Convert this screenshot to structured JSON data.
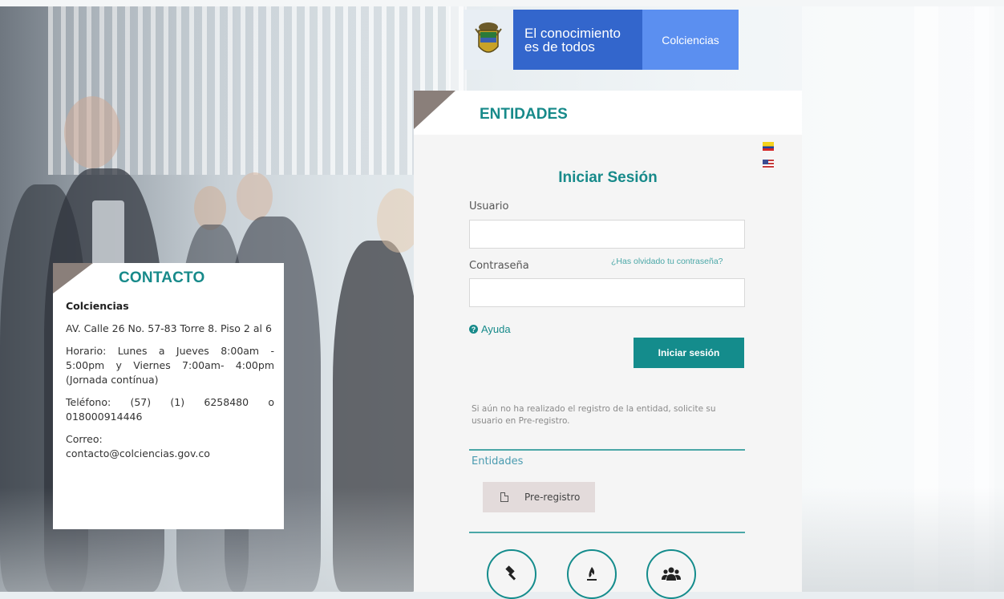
{
  "banner": {
    "slogan_line1": "El conocimiento",
    "slogan_line2": "es de todos",
    "brand": "Colciencias"
  },
  "contact": {
    "title": "CONTACTO",
    "org": "Colciencias",
    "address": "AV. Calle 26 No. 57-83 Torre 8. Piso 2 al 6",
    "hours": "Horario: Lunes a Jueves 8:00am - 5:00pm y Viernes 7:00am- 4:00pm (Jornada contínua)",
    "phone": "Teléfono: (57) (1) 6258480 o 018000914446",
    "email_label": "Correo:",
    "email": "contacto@colciencias.gov.co"
  },
  "panel": {
    "tab_title": "ENTIDADES",
    "login_title": "Iniciar Sesión",
    "user_label": "Usuario",
    "user_value": "",
    "password_label": "Contraseña",
    "password_value": "",
    "forgot_link": "¿Has olvidado tu contraseña?",
    "help_link": "Ayuda",
    "login_button": "Iniciar sesión",
    "note": "Si aún no ha realizado el registro de la entidad, solicite su usuario en Pre-registro.",
    "entities_label": "Entidades",
    "preregistro_button": "Pre-registro"
  },
  "icons": {
    "flags": [
      "flag-colombia-icon",
      "flag-usa-icon"
    ],
    "circle_buttons": [
      "gavel-icon",
      "flame-icon",
      "users-icon"
    ]
  },
  "colors": {
    "teal": "#148c8c",
    "banner_blue": "#3366cc",
    "brand_blue": "#5b8ff0",
    "corner_brown": "#8a7f7a"
  }
}
